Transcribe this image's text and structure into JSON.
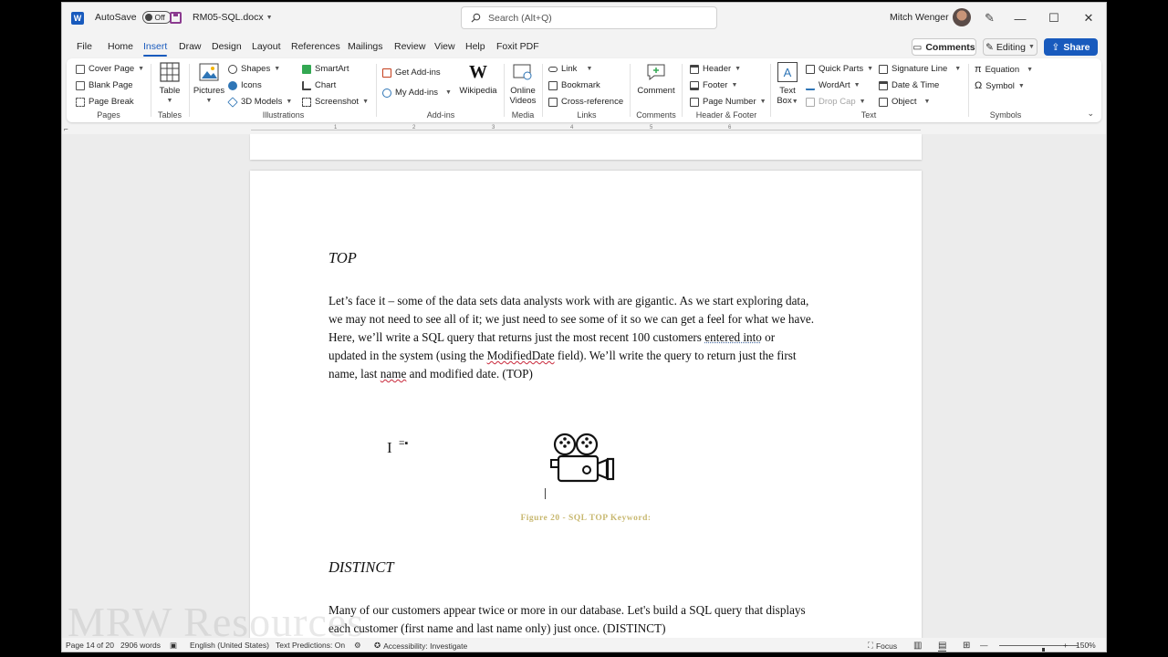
{
  "titlebar": {
    "app_icon": "W",
    "autosave_label": "AutoSave",
    "autosave_state": "Off",
    "filename": "RM05-SQL.docx",
    "search_placeholder": "Search (Alt+Q)",
    "user_name": "Mitch Wenger"
  },
  "menu": {
    "tabs": [
      "File",
      "Home",
      "Insert",
      "Draw",
      "Design",
      "Layout",
      "References",
      "Mailings",
      "Review",
      "View",
      "Help",
      "Foxit PDF"
    ],
    "active_tab": "Insert",
    "comments_label": "Comments",
    "editing_label": "Editing",
    "share_label": "Share"
  },
  "ribbon": {
    "pages": {
      "label": "Pages",
      "cover_page": "Cover Page",
      "blank_page": "Blank Page",
      "page_break": "Page Break"
    },
    "tables": {
      "label": "Tables",
      "table": "Table"
    },
    "illustrations": {
      "label": "Illustrations",
      "pictures": "Pictures",
      "shapes": "Shapes",
      "icons": "Icons",
      "models": "3D Models",
      "smartart": "SmartArt",
      "chart": "Chart",
      "screenshot": "Screenshot"
    },
    "addins": {
      "label": "Add-ins",
      "get_addins": "Get Add-ins",
      "my_addins": "My Add-ins",
      "wikipedia": "Wikipedia"
    },
    "media": {
      "label": "Media",
      "online_line1": "Online",
      "online_line2": "Videos"
    },
    "links": {
      "label": "Links",
      "link": "Link",
      "bookmark": "Bookmark",
      "cross_reference": "Cross-reference"
    },
    "comments": {
      "label": "Comments",
      "comment": "Comment"
    },
    "header_footer": {
      "label": "Header & Footer",
      "header": "Header",
      "footer": "Footer",
      "page_number": "Page Number"
    },
    "text": {
      "label": "Text",
      "textbox_line1": "Text",
      "textbox_line2": "Box",
      "quick_parts": "Quick Parts",
      "wordart": "WordArt",
      "drop_cap": "Drop Cap",
      "signature_line": "Signature Line",
      "date_time": "Date & Time",
      "object": "Object"
    },
    "symbols": {
      "label": "Symbols",
      "equation": "Equation",
      "symbol": "Symbol"
    }
  },
  "ruler": {
    "numbers": [
      "1",
      "2",
      "3",
      "4",
      "5",
      "6"
    ]
  },
  "document": {
    "heading_top": "TOP",
    "para_top": {
      "l1": "Let’s face it – some of the data sets data analysts work with are gigantic. As we start exploring data,",
      "l2": "we may not need to see all of it; we just need to see some of it so we can get a feel for what we have.",
      "l3_a": "Here, we’ll write a SQL query that returns just the most recent 100 customers ",
      "l3_b": "entered into",
      "l3_c": " or",
      "l4_a": "updated in the system (using the ",
      "l4_b": "ModifiedDate",
      "l4_c": " field). We’ll write the query to return just the first",
      "l5_a": "name, last ",
      "l5_b": "name",
      "l5_c": " and modified date. (TOP)"
    },
    "handle_mark": "=▪",
    "ibeam": "I",
    "figure_caption": "Figure 20 - SQL TOP Keyword:",
    "heading_distinct": "DISTINCT",
    "para_distinct": {
      "l1": "Many of our customers appear twice or more in our database. Let's build a SQL query that displays",
      "l2": "each customer (first name and last name only) just once. (DISTINCT)"
    }
  },
  "statusbar": {
    "page": "Page 14 of 20",
    "words": "2906 words",
    "language": "English (United States)",
    "text_predictions": "Text Predictions: On",
    "accessibility": "Accessibility: Investigate",
    "focus": "Focus",
    "zoom": "150%",
    "zoom_fraction": 0.55
  },
  "watermark": "MRW Resources",
  "colors": {
    "accent": "#185abd",
    "caption": "#c8b870",
    "spelling": "#c8273a"
  }
}
